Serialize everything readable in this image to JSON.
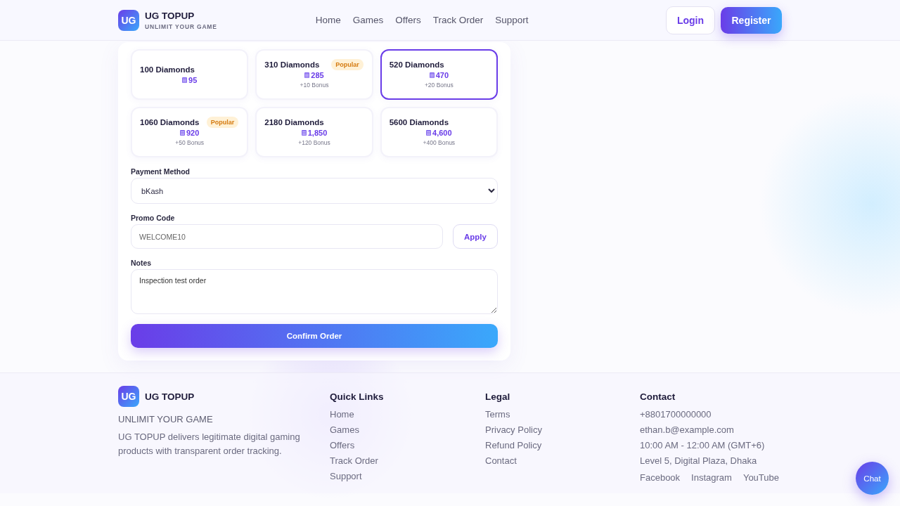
{
  "header": {
    "logo": "UG",
    "name": "UG TOPUP",
    "tagline": "UNLIMIT YOUR GAME",
    "nav": [
      {
        "label": "Home"
      },
      {
        "label": "Games"
      },
      {
        "label": "Offers"
      },
      {
        "label": "Track Order"
      },
      {
        "label": "Support"
      }
    ],
    "login": "Login",
    "register": "Register"
  },
  "packages": [
    {
      "title": "100 Diamonds",
      "price": "95",
      "selected": false
    },
    {
      "title": "310 Diamonds",
      "price": "285",
      "bonus": "+10 Bonus",
      "badge": "Popular",
      "selected": false
    },
    {
      "title": "520 Diamonds",
      "price": "470",
      "bonus": "+20 Bonus",
      "selected": true
    },
    {
      "title": "1060 Diamonds",
      "price": "920",
      "bonus": "+50 Bonus",
      "badge": "Popular",
      "selected": false
    },
    {
      "title": "2180 Diamonds",
      "price": "1,850",
      "bonus": "+120 Bonus",
      "selected": false
    },
    {
      "title": "5600 Diamonds",
      "price": "4,600",
      "bonus": "+400 Bonus",
      "selected": false
    }
  ],
  "payment": {
    "label": "Payment Method",
    "value": "bKash"
  },
  "promo": {
    "label": "Promo Code",
    "value": "WELCOME10",
    "button": "Apply"
  },
  "notes": {
    "label": "Notes",
    "value": "Inspection test order"
  },
  "submit": "Confirm Order",
  "footer": {
    "logo": "UG",
    "name": "UG TOPUP",
    "tagline": "UNLIMIT YOUR GAME",
    "description": "UG TOPUP delivers legitimate digital gaming products with transparent order tracking.",
    "columns": [
      {
        "title": "Quick Links",
        "links": [
          "Home",
          "Games",
          "Offers",
          "Track Order",
          "Support"
        ]
      },
      {
        "title": "Legal",
        "links": [
          "Terms",
          "Privacy Policy",
          "Refund Policy",
          "Contact"
        ]
      },
      {
        "title": "Contact",
        "links": [
          "+8801700000000",
          "ethan.b@example.com",
          "10:00 AM - 12:00 AM (GMT+6)",
          "Level 5, Digital Plaza, Dhaka"
        ],
        "social": [
          "Facebook",
          "Instagram",
          "YouTube"
        ]
      }
    ]
  },
  "chat": "Chat"
}
